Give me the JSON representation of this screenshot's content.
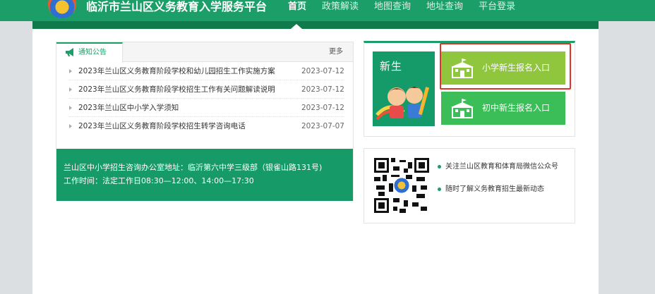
{
  "header": {
    "site_title": "临沂市兰山区义务教育入学服务平台",
    "nav": [
      "首页",
      "政策解读",
      "地图查询",
      "地址查询",
      "平台登录"
    ],
    "active_nav": "首页"
  },
  "news": {
    "tab_label": "通知公告",
    "more_label": "更多",
    "items": [
      {
        "title": "2023年兰山区义务教育阶段学校和幼儿园招生工作实施方案",
        "date": "2023-07-12"
      },
      {
        "title": "2023年兰山区义务教育阶段学校招生工作有关问题解读说明",
        "date": "2023-07-12"
      },
      {
        "title": "2023年兰山区中小学入学须知",
        "date": "2023-07-12"
      },
      {
        "title": "2023年兰山区义务教育阶段学校招生转学咨询电话",
        "date": "2023-07-07"
      }
    ],
    "notice_line1": "兰山区中小学招生咨询办公室地址：临沂第六中学三级部（银雀山路131号)",
    "notice_line2": "工作时间：法定工作日08:30—12:00、14:00—17:30"
  },
  "registration": {
    "newborn_label": "新生",
    "primary_button": "小学新生报名入口",
    "middle_button": "初中新生报名入口"
  },
  "wechat": {
    "line1": "关注兰山区教育和体育局微信公众号",
    "line2": "随时了解义务教育招生最新动态"
  },
  "colors": {
    "brand_green": "#1b9e67",
    "primary_button": "#8fc63d",
    "middle_button": "#3bbe57",
    "highlight": "#e0342b"
  }
}
